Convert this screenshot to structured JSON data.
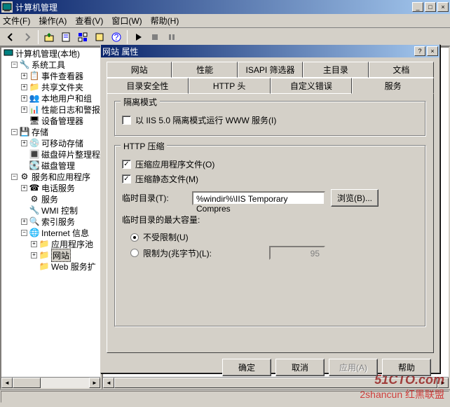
{
  "window": {
    "title": "计算机管理",
    "min": "_",
    "max": "□",
    "close": "×"
  },
  "menu": {
    "file": "文件(F)",
    "action": "操作(A)",
    "view": "查看(V)",
    "window": "窗口(W)",
    "help": "帮助(H)"
  },
  "tree": {
    "root": "计算机管理(本地)",
    "systools": "系统工具",
    "evtviewer": "事件查看器",
    "shared": "共享文件夹",
    "users": "本地用户和组",
    "perflogs": "性能日志和警报",
    "devmgr": "设备管理器",
    "storage": "存储",
    "removable": "可移动存储",
    "defrag": "磁盘碎片整理程",
    "diskmgmt": "磁盘管理",
    "services_apps": "服务和应用程序",
    "telephony": "电话服务",
    "services": "服务",
    "wmi": "WMI 控制",
    "indexing": "索引服务",
    "iis": "Internet 信息",
    "apppools": "应用程序池",
    "websites": "网站",
    "webext": "Web 服务扩"
  },
  "dialog": {
    "title": "网站 属性",
    "help": "?",
    "close": "×",
    "tabs_row1": {
      "website": "网站",
      "perf": "性能",
      "isapi": "ISAPI 筛选器",
      "homedir": "主目录",
      "docs": "文档"
    },
    "tabs_row2": {
      "dirsec": "目录安全性",
      "httphdr": "HTTP 头",
      "customerr": "自定义错误",
      "service": "服务"
    },
    "isolation": {
      "legend": "隔离模式",
      "iis5": "以 IIS 5.0 隔离模式运行 WWW 服务(I)"
    },
    "compress": {
      "legend": "HTTP 压缩",
      "appfiles": "压缩应用程序文件(O)",
      "staticfiles": "压缩静态文件(M)",
      "tempdir_label": "临时目录(T):",
      "tempdir_value": "%windir%\\IIS Temporary Compres",
      "browse": "浏览(B)...",
      "maxsize_label": "临时目录的最大容量:",
      "unlimited": "不受限制(U)",
      "limited": "限制为(兆字节)(L):",
      "limit_value": "95"
    },
    "buttons": {
      "ok": "确定",
      "cancel": "取消",
      "apply": "应用(A)",
      "help": "帮助"
    }
  },
  "watermark": {
    "line1": "51CTO.com",
    "line2": "2shancun 红黑联盟"
  }
}
